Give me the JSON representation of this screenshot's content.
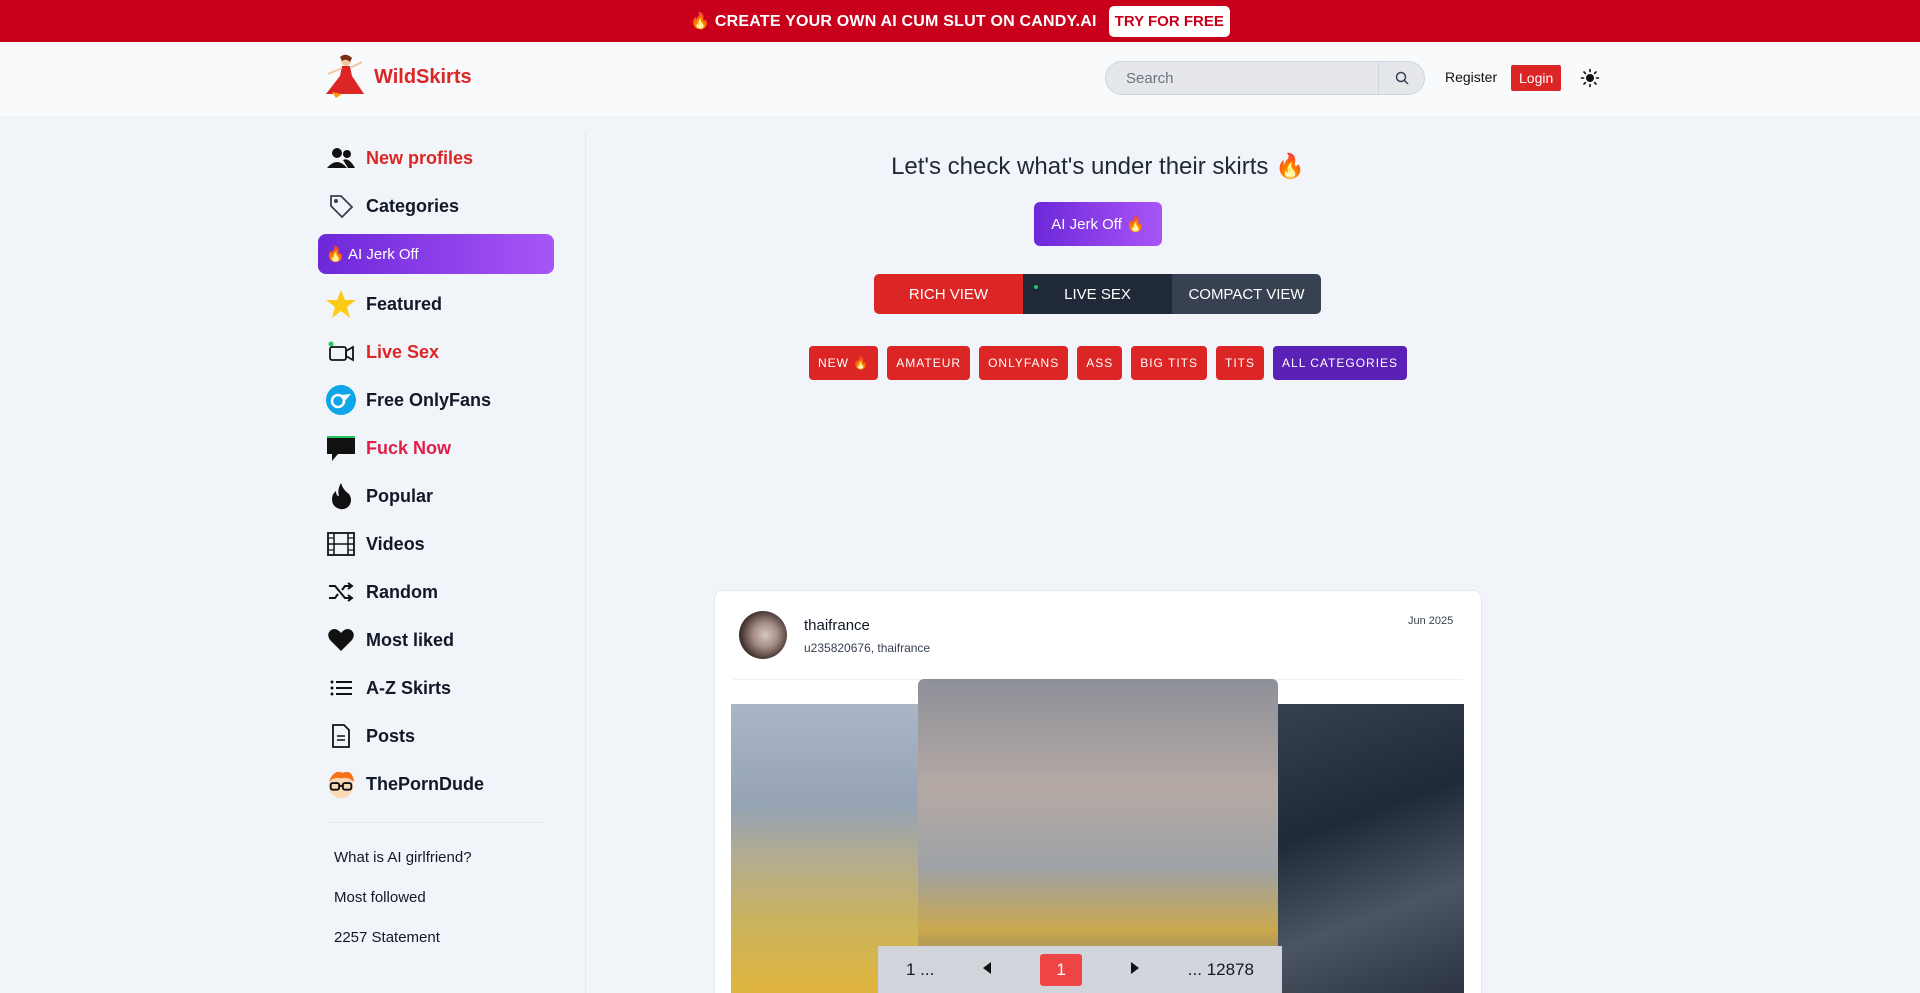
{
  "promo": {
    "text": "🔥 CREATE YOUR OWN AI CUM SLUT ON CANDY.AI",
    "button": "TRY FOR FREE"
  },
  "header": {
    "brand": "WildSkirts",
    "search_placeholder": "Search",
    "register": "Register",
    "login": "Login"
  },
  "sidebar": {
    "items": [
      {
        "label": "New profiles",
        "icon": "users-icon"
      },
      {
        "label": "Categories",
        "icon": "tag-icon"
      },
      {
        "label": "🔥 AI Jerk Off",
        "icon": "fire-icon"
      },
      {
        "label": "Featured",
        "icon": "star-icon"
      },
      {
        "label": "Live Sex",
        "icon": "video-camera-icon"
      },
      {
        "label": "Free OnlyFans",
        "icon": "onlyfans-icon"
      },
      {
        "label": "Fuck Now",
        "icon": "chat-bubble-icon"
      },
      {
        "label": "Popular",
        "icon": "flame-icon"
      },
      {
        "label": "Videos",
        "icon": "film-icon"
      },
      {
        "label": "Random",
        "icon": "shuffle-icon"
      },
      {
        "label": "Most liked",
        "icon": "heart-icon"
      },
      {
        "label": "A-Z Skirts",
        "icon": "list-icon"
      },
      {
        "label": "Posts",
        "icon": "document-icon"
      },
      {
        "label": "ThePornDude",
        "icon": "porndude-icon"
      }
    ],
    "links": [
      "What is AI girlfriend?",
      "Most followed",
      "2257 Statement"
    ]
  },
  "main": {
    "headline": "Let's check what's under their skirts 🔥",
    "ai_button": "AI Jerk Off 🔥",
    "views": [
      "RICH VIEW",
      "LIVE SEX",
      "COMPACT VIEW"
    ],
    "tags": [
      "NEW 🔥",
      "AMATEUR",
      "ONLYFANS",
      "ASS",
      "BIG TITS",
      "TITS",
      "ALL CATEGORIES"
    ]
  },
  "post": {
    "username": "thaifrance",
    "aliases": "u235820676, thaifrance",
    "date": "Jun 2025"
  },
  "pager": {
    "first": "1 ...",
    "current": "1",
    "last": "... 12878"
  },
  "colors": {
    "brand_red": "#dc2626",
    "promo_red": "#c8001b",
    "purple": "#6d28d9"
  }
}
